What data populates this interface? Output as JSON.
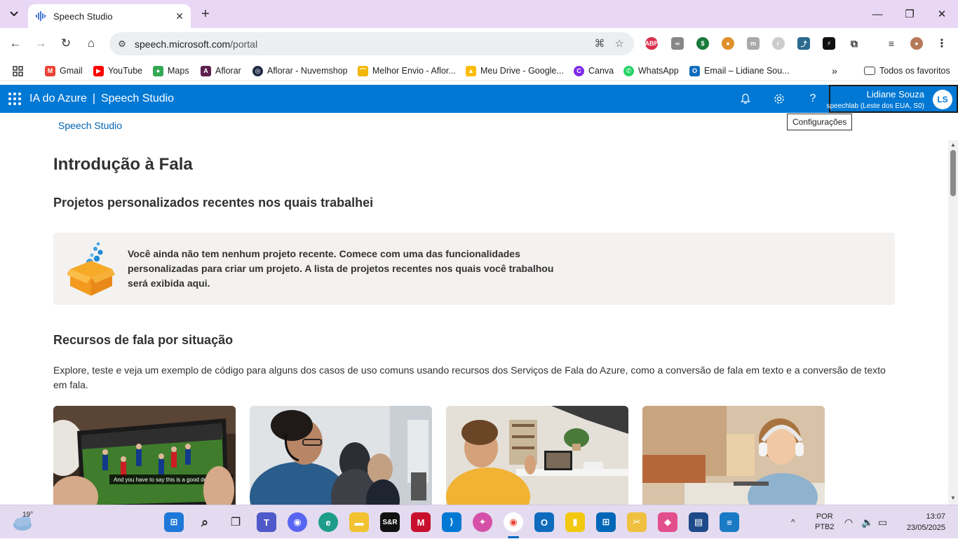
{
  "browser": {
    "tab_title": "Speech Studio",
    "url_domain": "speech.microsoft.com",
    "url_path": "/portal",
    "bookmarks": [
      {
        "label": "Gmail",
        "icon": "gmail-icon",
        "color": "#ea4335"
      },
      {
        "label": "YouTube",
        "icon": "youtube-icon",
        "color": "#ff0000"
      },
      {
        "label": "Maps",
        "icon": "maps-icon",
        "color": "#34a853"
      },
      {
        "label": "Aflorar",
        "icon": "aflorar-icon",
        "color": "#5b1f4f"
      },
      {
        "label": "Aflorar - Nuvemshop",
        "icon": "nuvemshop-icon",
        "color": "#1f2a44"
      },
      {
        "label": "Melhor Envio - Aflor...",
        "icon": "melhor-envio-icon",
        "color": "#f2b705"
      },
      {
        "label": "Meu Drive - Google...",
        "icon": "drive-icon",
        "color": "#fbbc04"
      },
      {
        "label": "Canva",
        "icon": "canva-icon",
        "color": "#7d2ae8"
      },
      {
        "label": "WhatsApp",
        "icon": "whatsapp-icon",
        "color": "#25d366"
      },
      {
        "label": "Email – Lidiane Sou...",
        "icon": "outlook-icon",
        "color": "#0f6cbd"
      }
    ],
    "all_bookmarks": "Todos os favoritos"
  },
  "azure": {
    "brand": "IA do Azure",
    "product": "Speech Studio",
    "user_name": "Lidiane Souza",
    "user_resource": "speechlab (Leste dos EUA, S0)",
    "user_initials": "LS",
    "tooltip": "Configurações",
    "accent": "#0078d4"
  },
  "page": {
    "breadcrumb": "Speech Studio",
    "title": "Introdução à Fala",
    "recent_title": "Projetos personalizados recentes nos quais trabalhei",
    "empty_message": "Você ainda não tem nenhum projeto recente. Comece com uma das funcionalidades personalizadas para criar um projeto. A lista de projetos recentes nos quais você trabalhou será exibida aqui.",
    "scenarios_title": "Recursos de fala por situação",
    "scenarios_desc": "Explore, teste e veja um exemplo de código para alguns dos casos de uso comuns usando recursos dos Serviços de Fala do Azure, como a conversão de fala em texto e a conversão de texto em fala.",
    "card1_caption": "And you have to say this is a good defense."
  },
  "taskbar": {
    "temperature": "19°",
    "lang_top": "POR",
    "lang_bottom": "PTB2",
    "time": "13:07",
    "date": "23/05/2025"
  }
}
